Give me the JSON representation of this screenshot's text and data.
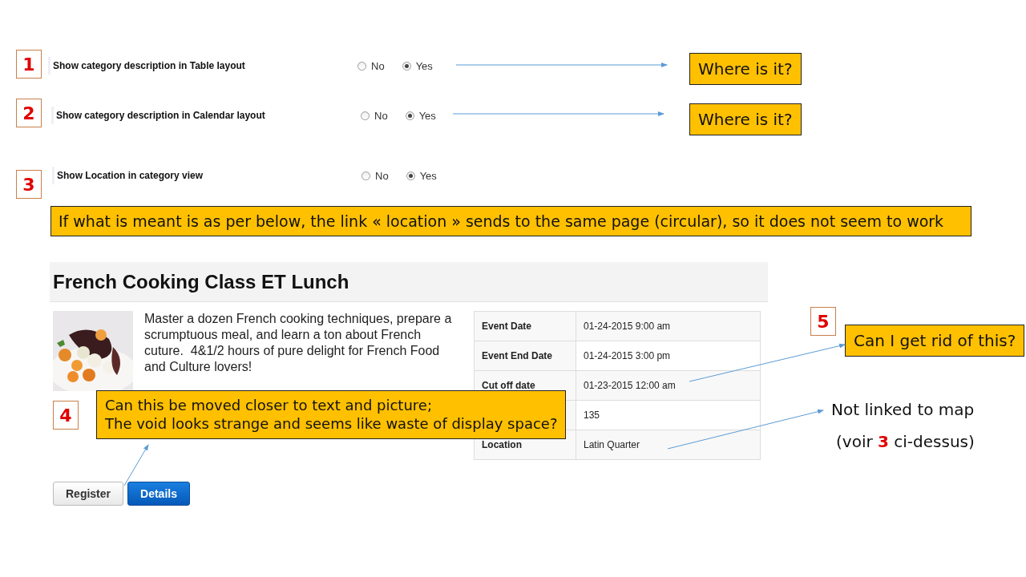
{
  "settings": [
    {
      "number": "1",
      "label": "Show category description in Table layout",
      "options": [
        {
          "label": "No",
          "selected": false
        },
        {
          "label": "Yes",
          "selected": true
        }
      ],
      "callout": "Where is it?"
    },
    {
      "number": "2",
      "label": "Show category description in Calendar layout",
      "options": [
        {
          "label": "No",
          "selected": false
        },
        {
          "label": "Yes",
          "selected": true
        }
      ],
      "callout": "Where is it?"
    },
    {
      "number": "3",
      "label": "Show Location in category view",
      "options": [
        {
          "label": "No",
          "selected": false
        },
        {
          "label": "Yes",
          "selected": true
        }
      ]
    }
  ],
  "note": "If what is meant is as per below, the link « location » sends to the same page (circular), so it does not seem to work",
  "event": {
    "title": "French Cooking Class ET Lunch",
    "description": "Master a dozen French cooking techniques, prepare a scrumptuous meal, and learn a ton about French cuture.  4&1/2 hours of pure delight for French Food and Culture lovers!",
    "details": [
      {
        "label": "Event Date",
        "value": "01-24-2015 9:00 am"
      },
      {
        "label": "Event End Date",
        "value": "01-24-2015 3:00 pm"
      },
      {
        "label": "Cut off date",
        "value": "01-23-2015 12:00 am"
      },
      {
        "value": "135"
      },
      {
        "label": "Location",
        "value": "Latin Quarter"
      }
    ],
    "buttons": [
      {
        "label": "Register",
        "kind": "secondary"
      },
      {
        "label": "Details",
        "kind": "primary"
      }
    ]
  },
  "remarks": [
    {
      "number": "4",
      "lines": [
        "Can this be moved closer to text and picture;",
        "The void looks strange and seems like waste of display space?"
      ]
    },
    {
      "number": "5",
      "lines": [
        "Can I get rid of this?"
      ]
    },
    {
      "lines": [
        "Not linked to map",
        "(voir **3** ci-dessus)"
      ]
    }
  ]
}
